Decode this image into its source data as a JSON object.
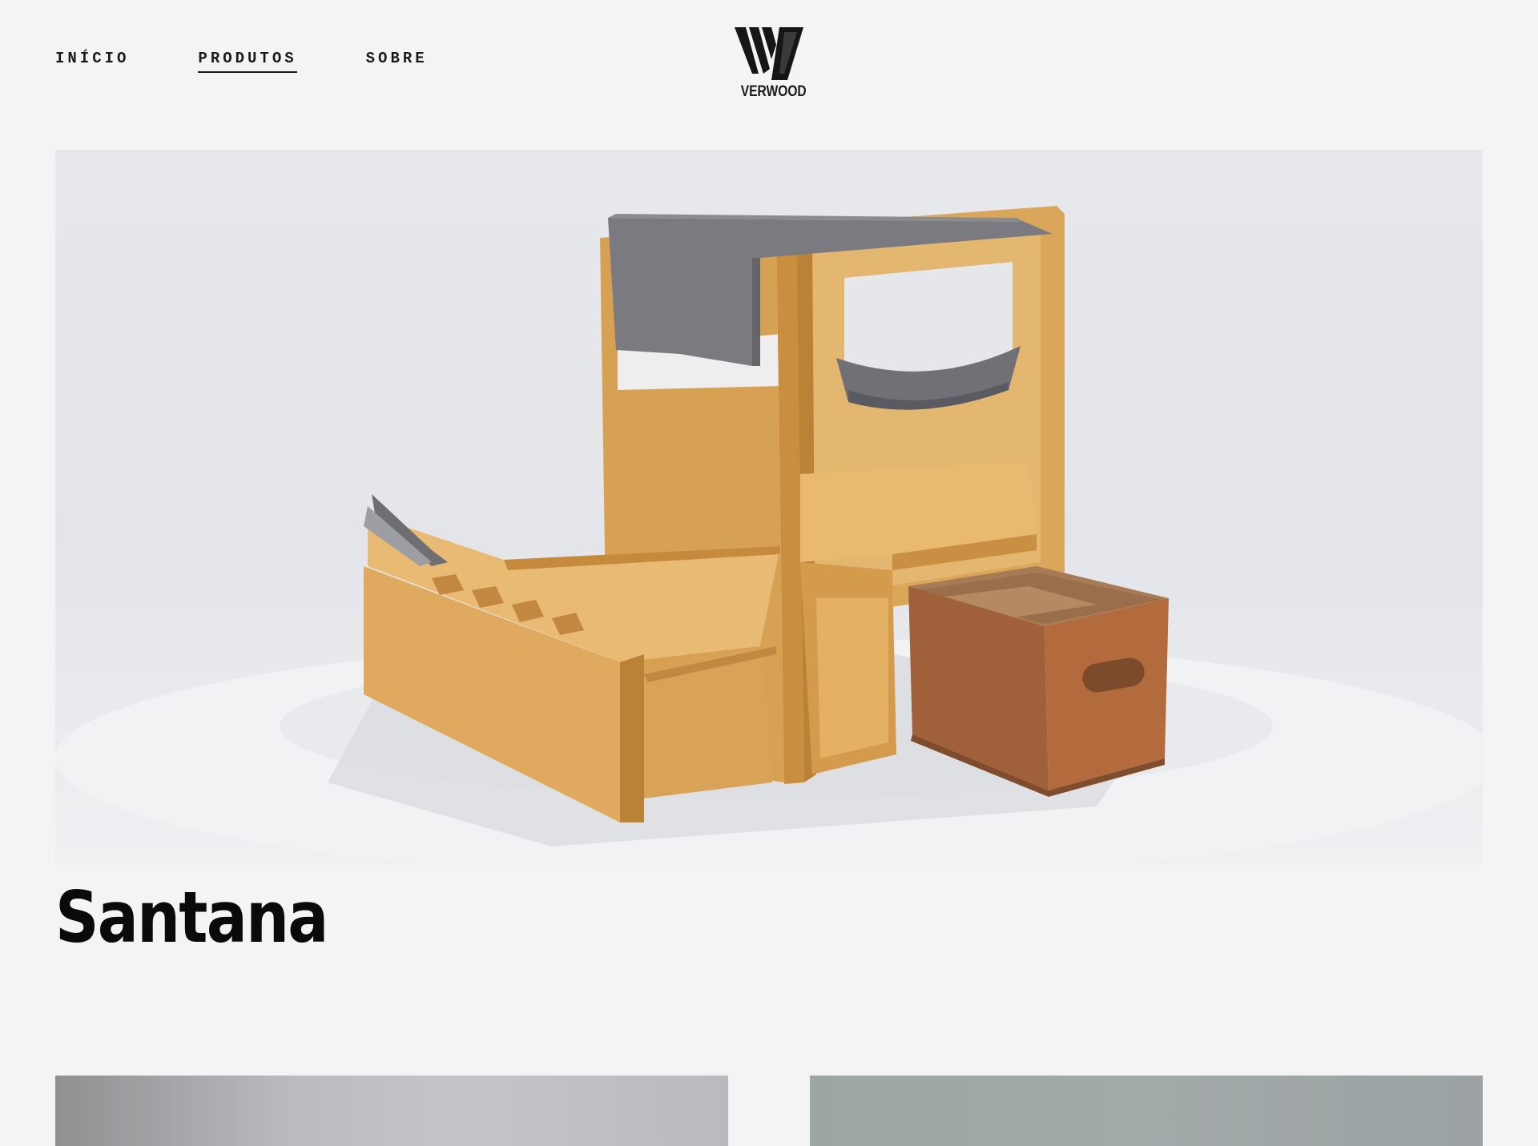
{
  "nav": {
    "items": [
      {
        "label": "INÍCIO",
        "active": false
      },
      {
        "label": "PRODUTOS",
        "active": true
      },
      {
        "label": "SOBRE",
        "active": false
      }
    ]
  },
  "logo": {
    "mark": "W",
    "text": "VERWOOD"
  },
  "product": {
    "title": "Santana",
    "hero_image": "plywood-cat-furniture-with-drawer"
  },
  "colors": {
    "background": "#f4f4f4",
    "text": "#111111"
  }
}
